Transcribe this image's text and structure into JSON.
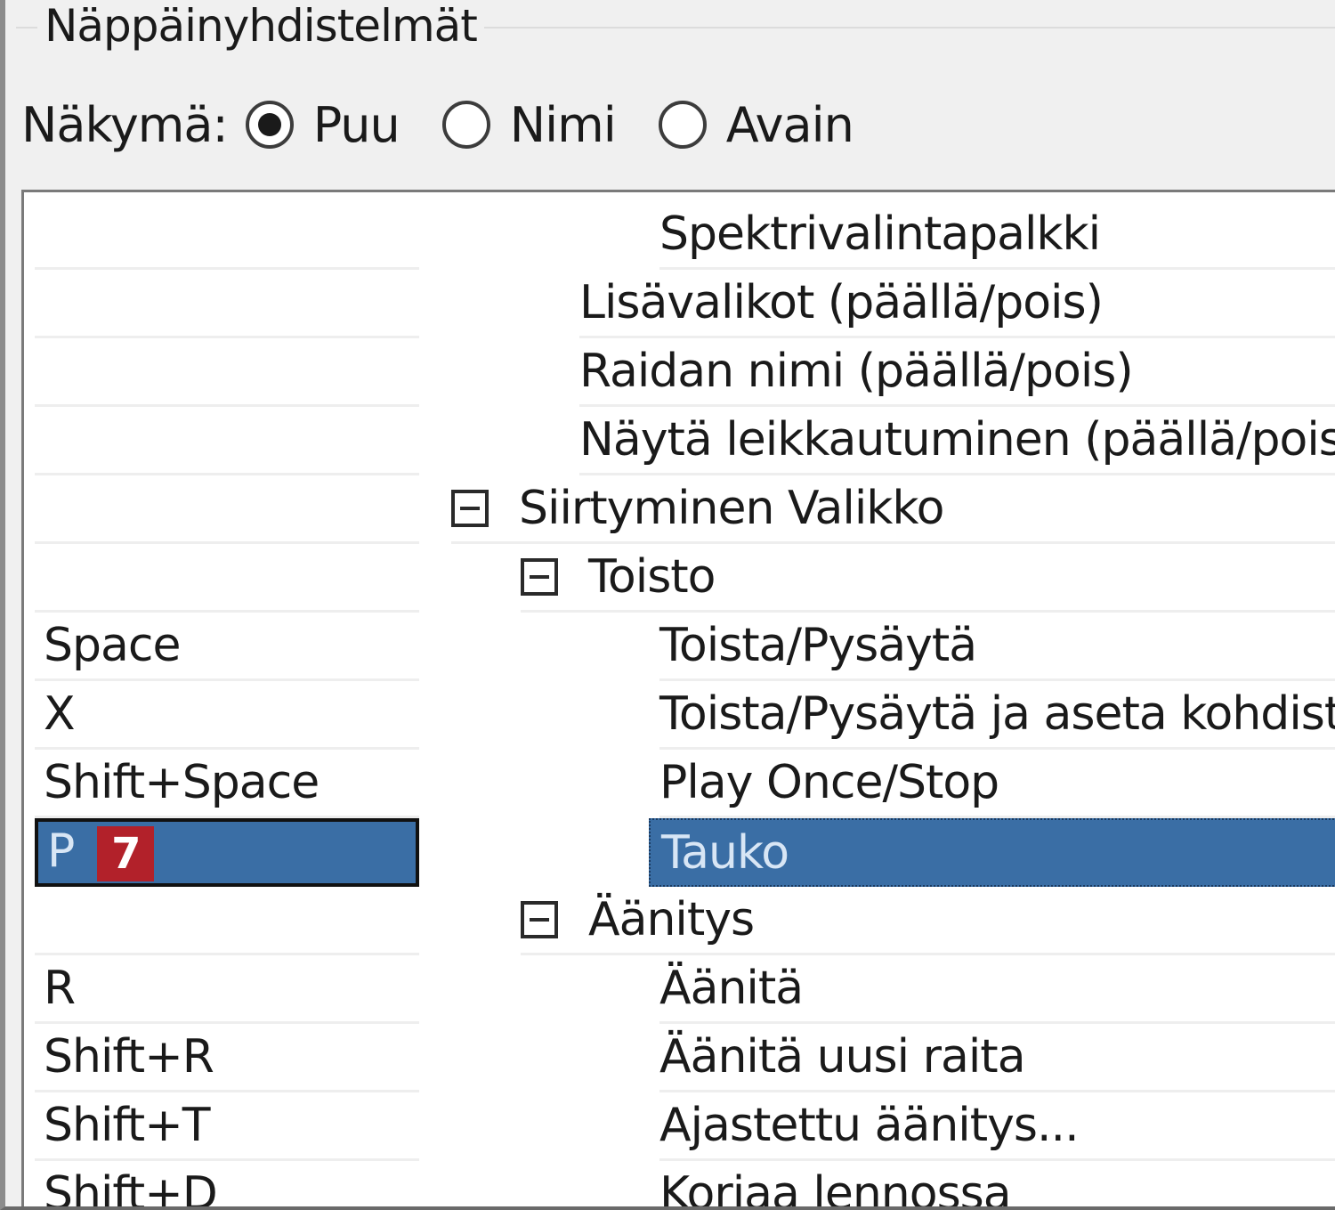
{
  "groupbox": {
    "title": "Näppäinyhdistelmät"
  },
  "view": {
    "label": "Näkymä:",
    "options": [
      {
        "label": "Puu",
        "selected": true
      },
      {
        "label": "Nimi",
        "selected": false
      },
      {
        "label": "Avain",
        "selected": false
      }
    ]
  },
  "rows": [
    {
      "key": "",
      "name": "Spektrivalintapalkki"
    },
    {
      "key": "",
      "name": "Lisävalikot (päällä/pois)"
    },
    {
      "key": "",
      "name": "Raidan nimi (päällä/pois)"
    },
    {
      "key": "",
      "name": "Näytä leikkautuminen (päällä/pois)"
    },
    {
      "key": "",
      "name": "Siirtyminen Valikko"
    },
    {
      "key": "",
      "name": "Toisto"
    },
    {
      "key": "Space",
      "name": "Toista/Pysäytä"
    },
    {
      "key": "X",
      "name": "Toista/Pysäytä ja aseta kohdistin"
    },
    {
      "key": "Shift+Space",
      "name": "Play Once/Stop"
    },
    {
      "key": "P",
      "badge": "7",
      "name": "Tauko"
    },
    {
      "key": "",
      "name": "Äänitys"
    },
    {
      "key": "R",
      "name": "Äänitä"
    },
    {
      "key": "Shift+R",
      "name": "Äänitä uusi raita"
    },
    {
      "key": "Shift+T",
      "name": "Ajastettu äänitys..."
    },
    {
      "key": "Shift+D",
      "name": "Korjaa lennossa"
    }
  ],
  "colors": {
    "selection": "#3a6ea5",
    "badge": "#b2212a"
  }
}
